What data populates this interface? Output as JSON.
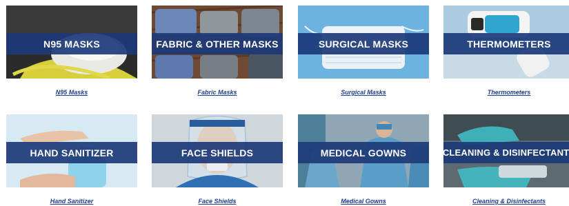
{
  "products": [
    {
      "banner": "N95 Masks",
      "link": "N95 Masks",
      "icon": "n95-mask-photo"
    },
    {
      "banner": "Fabric & Other Masks",
      "link": "Fabric Masks",
      "icon": "fabric-masks-photo"
    },
    {
      "banner": "Surgical Masks",
      "link": "Surgical Masks",
      "icon": "surgical-mask-photo"
    },
    {
      "banner": "Thermometers",
      "link": "Thermometers",
      "icon": "thermometer-photo"
    },
    {
      "banner": "Hand Sanitizer",
      "link": "Hand Sanitizer",
      "icon": "hand-sanitizer-photo"
    },
    {
      "banner": "Face Shields",
      "link": "Face Shields",
      "icon": "face-shield-photo"
    },
    {
      "banner": "Medical Gowns",
      "link": "Medical Gowns",
      "icon": "medical-gowns-photo"
    },
    {
      "banner": "Cleaning & Disinfectants",
      "link": "Cleaning & Disinfectants",
      "icon": "cleaning-photo"
    }
  ],
  "colors": {
    "banner": "#1c3a78",
    "link": "#1d3f8f"
  }
}
